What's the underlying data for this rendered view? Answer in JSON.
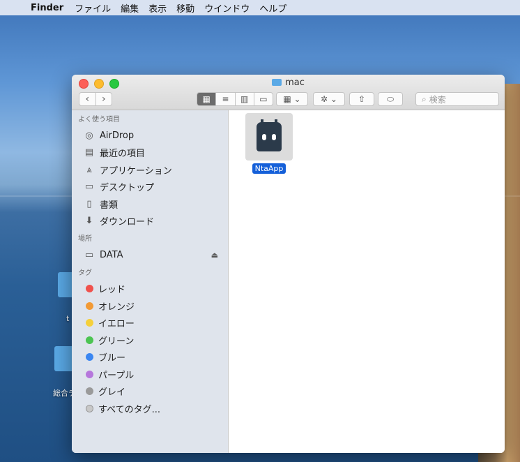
{
  "menubar": {
    "app_name": "Finder",
    "items": [
      "ファイル",
      "編集",
      "表示",
      "移動",
      "ウインドウ",
      "ヘルプ"
    ]
  },
  "window": {
    "title": "mac",
    "search_placeholder": "検索"
  },
  "sidebar": {
    "favorites_title": "よく使う項目",
    "favorites": [
      {
        "label": "AirDrop",
        "icon": "airdrop-icon"
      },
      {
        "label": "最近の項目",
        "icon": "recents-icon"
      },
      {
        "label": "アプリケーション",
        "icon": "applications-icon"
      },
      {
        "label": "デスクトップ",
        "icon": "desktop-icon"
      },
      {
        "label": "書類",
        "icon": "documents-icon"
      },
      {
        "label": "ダウンロード",
        "icon": "downloads-icon"
      }
    ],
    "locations_title": "場所",
    "locations": [
      {
        "label": "DATA",
        "icon": "drive-icon"
      }
    ],
    "tags_title": "タグ",
    "tags": [
      {
        "label": "レッド",
        "color": "#f0514c"
      },
      {
        "label": "オレンジ",
        "color": "#f29a35"
      },
      {
        "label": "イエロー",
        "color": "#f5d03b"
      },
      {
        "label": "グリーン",
        "color": "#4cc452"
      },
      {
        "label": "ブルー",
        "color": "#3a86f1"
      },
      {
        "label": "パープル",
        "color": "#b677dc"
      },
      {
        "label": "グレイ",
        "color": "#9a9a9a"
      },
      {
        "label": "すべてのタグ...",
        "color": "#c8c8c8"
      }
    ]
  },
  "main": {
    "files": [
      {
        "name": "NtaApp",
        "icon": "app-robot-icon",
        "selected": true
      }
    ]
  },
  "desktop": {
    "labels": [
      "t",
      "総合テ"
    ]
  }
}
